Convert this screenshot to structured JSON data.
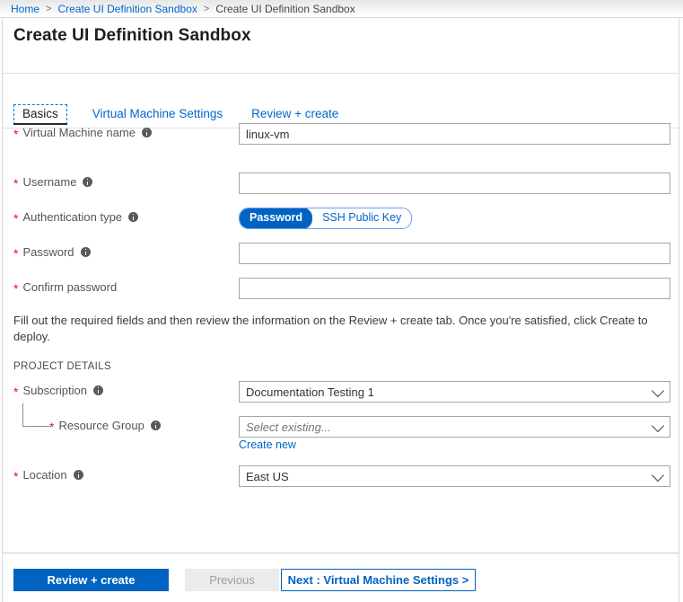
{
  "breadcrumb": {
    "items": [
      {
        "label": "Home",
        "link": true
      },
      {
        "label": "Create UI Definition Sandbox",
        "link": true
      },
      {
        "label": "Create UI Definition Sandbox",
        "link": false
      }
    ],
    "separator": ">"
  },
  "blade": {
    "title": "Create UI Definition Sandbox"
  },
  "tabs": [
    {
      "label": "Basics",
      "selected": true
    },
    {
      "label": "Virtual Machine Settings",
      "selected": false
    },
    {
      "label": "Review + create",
      "selected": false
    }
  ],
  "form": {
    "vm_name": {
      "label": "Virtual Machine name",
      "required_marker": "*",
      "info_icon": "info-icon",
      "value": "linux-vm",
      "placeholder": ""
    },
    "username": {
      "label": "Username",
      "required_marker": "*",
      "info_icon": "info-icon",
      "value": "",
      "placeholder": ""
    },
    "auth_type": {
      "label": "Authentication type",
      "required_marker": "*",
      "info_icon": "info-icon",
      "options": [
        {
          "label": "Password",
          "selected": true
        },
        {
          "label": "SSH Public Key",
          "selected": false
        }
      ]
    },
    "password": {
      "label": "Password",
      "required_marker": "*",
      "info_icon": "info-icon",
      "value": "",
      "placeholder": ""
    },
    "confirm_password": {
      "label": "Confirm password",
      "required_marker": "*",
      "value": "",
      "placeholder": ""
    },
    "helper_text": "Fill out the required fields and then review the information on the Review + create tab. Once you're satisfied, click Create to deploy.",
    "project_details_heading": "PROJECT DETAILS",
    "subscription": {
      "label": "Subscription",
      "required_marker": "*",
      "info_icon": "info-icon",
      "value": "Documentation Testing 1",
      "chevron": "chevron-down-icon"
    },
    "resource_group": {
      "label": "Resource Group",
      "required_marker": "*",
      "info_icon": "info-icon",
      "value": "",
      "placeholder": "Select existing...",
      "chevron": "chevron-down-icon",
      "create_new_label": "Create new"
    },
    "location": {
      "label": "Location",
      "required_marker": "*",
      "info_icon": "info-icon",
      "value": "East US",
      "chevron": "chevron-down-icon"
    }
  },
  "footer": {
    "review_create_label": "Review + create",
    "previous_label": "Previous",
    "next_label": "Next : Virtual Machine Settings >"
  },
  "colors": {
    "accent_blue": "#0063c1",
    "link_blue": "#0066cc",
    "required_red": "#e81123",
    "border_gray": "#a6a6a6",
    "disabled_gray": "#ebebeb"
  }
}
